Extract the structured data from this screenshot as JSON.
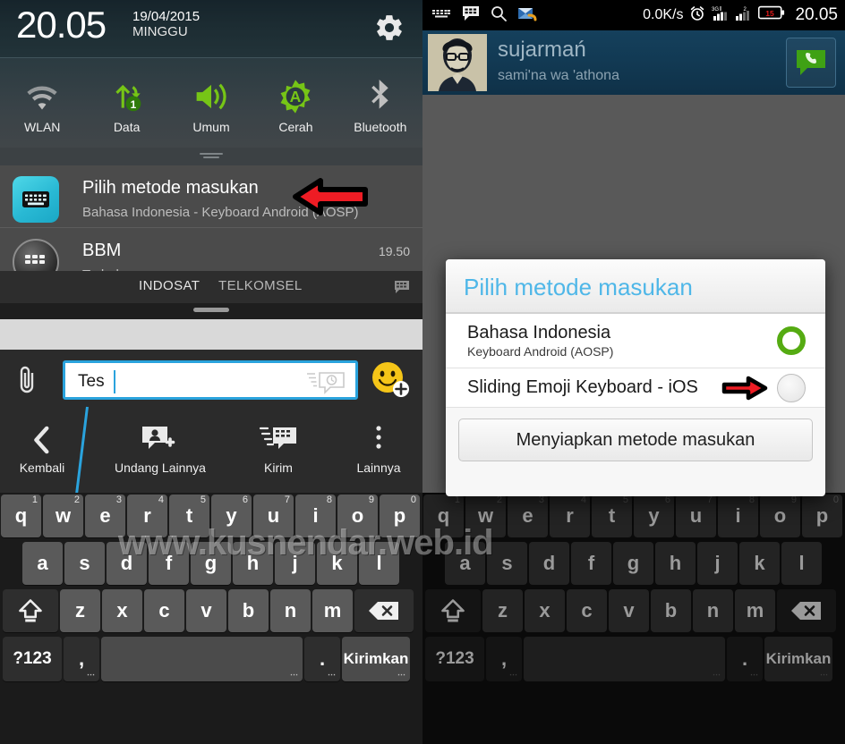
{
  "left_panel": {
    "quick_settings": {
      "clock": "20.05",
      "date": "19/04/2015",
      "day": "MINGGU",
      "gear_icon": "gear-icon",
      "toggles": [
        {
          "label": "WLAN",
          "icon": "wifi-icon",
          "active": false
        },
        {
          "label": "Data",
          "icon": "data-sync-icon",
          "active": true
        },
        {
          "label": "Umum",
          "icon": "volume-icon",
          "active": true
        },
        {
          "label": "Cerah",
          "icon": "brightness-auto-icon",
          "active": true
        },
        {
          "label": "Bluetooth",
          "icon": "bluetooth-icon",
          "active": false
        }
      ]
    },
    "notifications": [
      {
        "icon": "keyboard-icon",
        "title": "Pilih metode masukan",
        "subtitle": "Bahasa Indonesia - Keyboard Android (AOSP)",
        "time": ""
      },
      {
        "icon": "bbm-icon",
        "title": "BBM",
        "subtitle": "Terhubung",
        "time": "19.50"
      }
    ],
    "tabs": [
      {
        "label": "INDOSAT",
        "selected": true
      },
      {
        "label": "TELKOMSEL",
        "selected": false
      }
    ],
    "compose": {
      "attach_icon": "paperclip-icon",
      "message_value": "Tes",
      "ping_icon": "ping-bubble-icon",
      "emoji_icon": "emoji-add-icon"
    },
    "actions": [
      {
        "label": "Kembali",
        "icon": "back-chevron-icon"
      },
      {
        "label": "Undang Lainnya",
        "icon": "invite-contact-icon"
      },
      {
        "label": "Kirim",
        "icon": "send-bbm-icon"
      },
      {
        "label": "Lainnya",
        "icon": "overflow-dots-icon"
      }
    ],
    "keyboard": {
      "row1": [
        {
          "k": "q",
          "n": "1"
        },
        {
          "k": "w",
          "n": "2"
        },
        {
          "k": "e",
          "n": "3"
        },
        {
          "k": "r",
          "n": "4"
        },
        {
          "k": "t",
          "n": "5"
        },
        {
          "k": "y",
          "n": "6"
        },
        {
          "k": "u",
          "n": "7"
        },
        {
          "k": "i",
          "n": "8"
        },
        {
          "k": "o",
          "n": "9"
        },
        {
          "k": "p",
          "n": "0"
        }
      ],
      "row2": [
        "a",
        "s",
        "d",
        "f",
        "g",
        "h",
        "j",
        "k",
        "l"
      ],
      "row3": [
        "z",
        "x",
        "c",
        "v",
        "b",
        "n",
        "m"
      ],
      "shift_icon": "shift-icon",
      "delete_icon": "backspace-icon",
      "symbols_label": "?123",
      "comma_label": ",",
      "space_label": "",
      "period_label": ".",
      "send_label": "Kirimkan"
    }
  },
  "right_panel": {
    "statusbar": {
      "left_icons": [
        "keyboard-icon",
        "bbm-icon",
        "search-icon",
        "mail-icon"
      ],
      "net_speed": "0.0K/s",
      "alarm_icon": "alarm-icon",
      "signal1_icon": "signal-3g-icon",
      "signal2_icon": "signal-2-icon",
      "battery_level": "15",
      "clock": "20.05"
    },
    "contact": {
      "name": "sujarmań",
      "status": "sami'na wa 'athona",
      "avatar": "contact-avatar",
      "chat_icon": "chat-bubble-icon"
    },
    "dialog": {
      "title": "Pilih metode masukan",
      "items": [
        {
          "title": "Bahasa Indonesia",
          "subtitle": "Keyboard Android (AOSP)",
          "selected": true
        },
        {
          "title": "Sliding Emoji Keyboard - iOS",
          "subtitle": "",
          "selected": false
        }
      ],
      "button_label": "Menyiapkan metode masukan"
    },
    "keyboard": {
      "row1": [
        {
          "k": "q",
          "n": "1"
        },
        {
          "k": "w",
          "n": "2"
        },
        {
          "k": "e",
          "n": "3"
        },
        {
          "k": "r",
          "n": "4"
        },
        {
          "k": "t",
          "n": "5"
        },
        {
          "k": "y",
          "n": "6"
        },
        {
          "k": "u",
          "n": "7"
        },
        {
          "k": "i",
          "n": "8"
        },
        {
          "k": "o",
          "n": "9"
        },
        {
          "k": "p",
          "n": "0"
        }
      ],
      "row2": [
        "a",
        "s",
        "d",
        "f",
        "g",
        "h",
        "j",
        "k",
        "l"
      ],
      "row3": [
        "z",
        "x",
        "c",
        "v",
        "b",
        "n",
        "m"
      ],
      "symbols_label": "?123",
      "comma_label": ",",
      "period_label": ".",
      "send_label": "Kirimkan"
    }
  },
  "watermark": "www.kusnendar.web.id",
  "colors": {
    "accent_green": "#76c516",
    "accent_blue": "#2aa3dd",
    "dialog_title": "#4fb7e8",
    "radio_on": "#55ab12",
    "arrow_red": "#ee1c24",
    "header_blue": "#123a54"
  }
}
